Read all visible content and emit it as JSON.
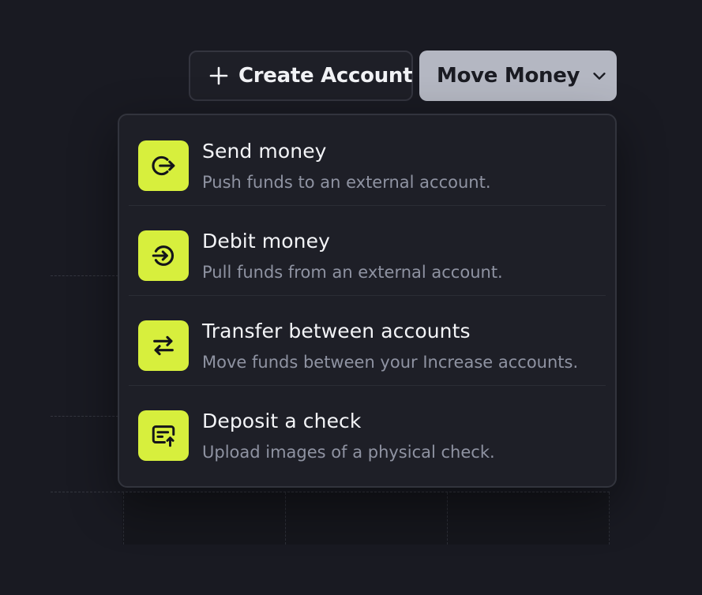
{
  "toolbar": {
    "create_label": "Create Account",
    "create_icon": "plus-icon",
    "move_label": "Move Money",
    "move_icon": "chevron-down-icon"
  },
  "menu": {
    "items": [
      {
        "title": "Send money",
        "description": "Push funds to an external account.",
        "icon": "send-arrow-out-icon"
      },
      {
        "title": "Debit money",
        "description": "Pull funds from an external account.",
        "icon": "debit-arrow-in-icon"
      },
      {
        "title": "Transfer between accounts",
        "description": "Move funds between your Increase accounts.",
        "icon": "transfer-arrows-icon"
      },
      {
        "title": "Deposit a check",
        "description": "Upload images of a physical check.",
        "icon": "check-upload-icon"
      }
    ]
  },
  "colors": {
    "background": "#191a22",
    "menu_background": "#1e1f27",
    "accent_icon": "#d7ef3d",
    "move_button": "#b4b7c2",
    "description_text": "#8f93a2"
  }
}
